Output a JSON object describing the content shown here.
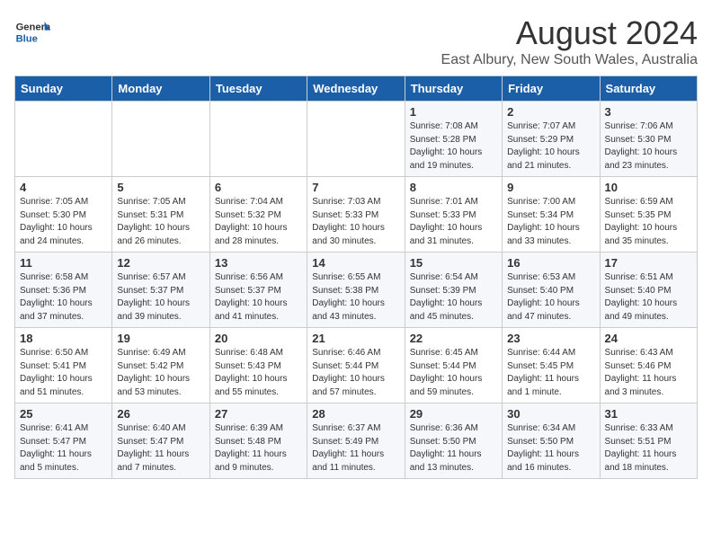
{
  "header": {
    "logo_general": "General",
    "logo_blue": "Blue",
    "month_title": "August 2024",
    "location": "East Albury, New South Wales, Australia"
  },
  "weekdays": [
    "Sunday",
    "Monday",
    "Tuesday",
    "Wednesday",
    "Thursday",
    "Friday",
    "Saturday"
  ],
  "weeks": [
    [
      {
        "day": "",
        "info": ""
      },
      {
        "day": "",
        "info": ""
      },
      {
        "day": "",
        "info": ""
      },
      {
        "day": "",
        "info": ""
      },
      {
        "day": "1",
        "info": "Sunrise: 7:08 AM\nSunset: 5:28 PM\nDaylight: 10 hours\nand 19 minutes."
      },
      {
        "day": "2",
        "info": "Sunrise: 7:07 AM\nSunset: 5:29 PM\nDaylight: 10 hours\nand 21 minutes."
      },
      {
        "day": "3",
        "info": "Sunrise: 7:06 AM\nSunset: 5:30 PM\nDaylight: 10 hours\nand 23 minutes."
      }
    ],
    [
      {
        "day": "4",
        "info": "Sunrise: 7:05 AM\nSunset: 5:30 PM\nDaylight: 10 hours\nand 24 minutes."
      },
      {
        "day": "5",
        "info": "Sunrise: 7:05 AM\nSunset: 5:31 PM\nDaylight: 10 hours\nand 26 minutes."
      },
      {
        "day": "6",
        "info": "Sunrise: 7:04 AM\nSunset: 5:32 PM\nDaylight: 10 hours\nand 28 minutes."
      },
      {
        "day": "7",
        "info": "Sunrise: 7:03 AM\nSunset: 5:33 PM\nDaylight: 10 hours\nand 30 minutes."
      },
      {
        "day": "8",
        "info": "Sunrise: 7:01 AM\nSunset: 5:33 PM\nDaylight: 10 hours\nand 31 minutes."
      },
      {
        "day": "9",
        "info": "Sunrise: 7:00 AM\nSunset: 5:34 PM\nDaylight: 10 hours\nand 33 minutes."
      },
      {
        "day": "10",
        "info": "Sunrise: 6:59 AM\nSunset: 5:35 PM\nDaylight: 10 hours\nand 35 minutes."
      }
    ],
    [
      {
        "day": "11",
        "info": "Sunrise: 6:58 AM\nSunset: 5:36 PM\nDaylight: 10 hours\nand 37 minutes."
      },
      {
        "day": "12",
        "info": "Sunrise: 6:57 AM\nSunset: 5:37 PM\nDaylight: 10 hours\nand 39 minutes."
      },
      {
        "day": "13",
        "info": "Sunrise: 6:56 AM\nSunset: 5:37 PM\nDaylight: 10 hours\nand 41 minutes."
      },
      {
        "day": "14",
        "info": "Sunrise: 6:55 AM\nSunset: 5:38 PM\nDaylight: 10 hours\nand 43 minutes."
      },
      {
        "day": "15",
        "info": "Sunrise: 6:54 AM\nSunset: 5:39 PM\nDaylight: 10 hours\nand 45 minutes."
      },
      {
        "day": "16",
        "info": "Sunrise: 6:53 AM\nSunset: 5:40 PM\nDaylight: 10 hours\nand 47 minutes."
      },
      {
        "day": "17",
        "info": "Sunrise: 6:51 AM\nSunset: 5:40 PM\nDaylight: 10 hours\nand 49 minutes."
      }
    ],
    [
      {
        "day": "18",
        "info": "Sunrise: 6:50 AM\nSunset: 5:41 PM\nDaylight: 10 hours\nand 51 minutes."
      },
      {
        "day": "19",
        "info": "Sunrise: 6:49 AM\nSunset: 5:42 PM\nDaylight: 10 hours\nand 53 minutes."
      },
      {
        "day": "20",
        "info": "Sunrise: 6:48 AM\nSunset: 5:43 PM\nDaylight: 10 hours\nand 55 minutes."
      },
      {
        "day": "21",
        "info": "Sunrise: 6:46 AM\nSunset: 5:44 PM\nDaylight: 10 hours\nand 57 minutes."
      },
      {
        "day": "22",
        "info": "Sunrise: 6:45 AM\nSunset: 5:44 PM\nDaylight: 10 hours\nand 59 minutes."
      },
      {
        "day": "23",
        "info": "Sunrise: 6:44 AM\nSunset: 5:45 PM\nDaylight: 11 hours\nand 1 minute."
      },
      {
        "day": "24",
        "info": "Sunrise: 6:43 AM\nSunset: 5:46 PM\nDaylight: 11 hours\nand 3 minutes."
      }
    ],
    [
      {
        "day": "25",
        "info": "Sunrise: 6:41 AM\nSunset: 5:47 PM\nDaylight: 11 hours\nand 5 minutes."
      },
      {
        "day": "26",
        "info": "Sunrise: 6:40 AM\nSunset: 5:47 PM\nDaylight: 11 hours\nand 7 minutes."
      },
      {
        "day": "27",
        "info": "Sunrise: 6:39 AM\nSunset: 5:48 PM\nDaylight: 11 hours\nand 9 minutes."
      },
      {
        "day": "28",
        "info": "Sunrise: 6:37 AM\nSunset: 5:49 PM\nDaylight: 11 hours\nand 11 minutes."
      },
      {
        "day": "29",
        "info": "Sunrise: 6:36 AM\nSunset: 5:50 PM\nDaylight: 11 hours\nand 13 minutes."
      },
      {
        "day": "30",
        "info": "Sunrise: 6:34 AM\nSunset: 5:50 PM\nDaylight: 11 hours\nand 16 minutes."
      },
      {
        "day": "31",
        "info": "Sunrise: 6:33 AM\nSunset: 5:51 PM\nDaylight: 11 hours\nand 18 minutes."
      }
    ]
  ]
}
